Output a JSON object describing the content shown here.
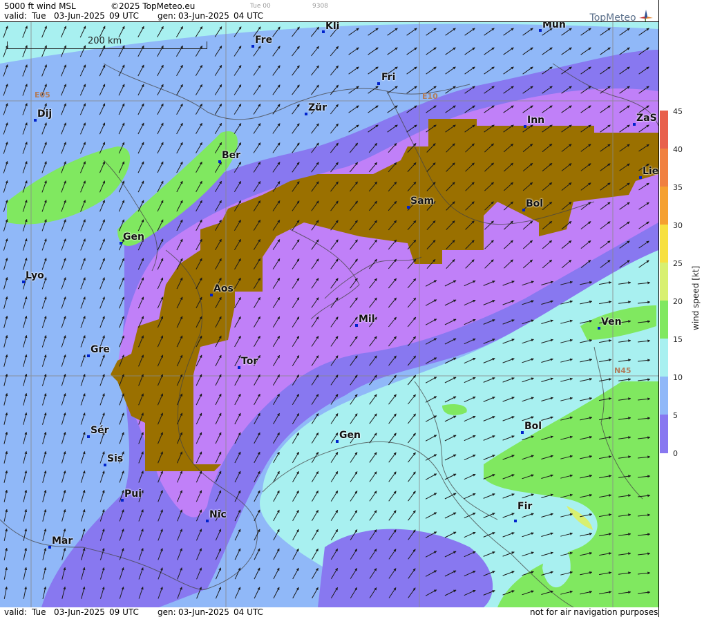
{
  "header": {
    "product": "5000 ft wind MSL",
    "copyright": "©2025 TopMeteo.eu",
    "valid_label": "valid:",
    "valid_day": "Tue",
    "valid_date": "03-Jun-2025",
    "valid_time": "09 UTC",
    "gen_label": "gen:",
    "gen_date": "03-Jun-2025",
    "gen_time": "04 UTC",
    "grey_tag1": "Tue 00",
    "grey_tag2": "9308"
  },
  "logo_text": "TopMeteo",
  "scale_label": "200 km",
  "grid_labels": {
    "e05": "E05",
    "e10": "E10",
    "n45": "N45"
  },
  "cities": [
    {
      "name": "Kli"
    },
    {
      "name": "Mün"
    },
    {
      "name": "Fre"
    },
    {
      "name": "Fri"
    },
    {
      "name": "Dij"
    },
    {
      "name": "Zür"
    },
    {
      "name": "Inn"
    },
    {
      "name": "ZaS"
    },
    {
      "name": "Ber"
    },
    {
      "name": "Lie"
    },
    {
      "name": "Sam"
    },
    {
      "name": "Bol"
    },
    {
      "name": "Gen"
    },
    {
      "name": "Lyo"
    },
    {
      "name": "Aos"
    },
    {
      "name": "Mil"
    },
    {
      "name": "Ven"
    },
    {
      "name": "Gre"
    },
    {
      "name": "Tor"
    },
    {
      "name": "Sér"
    },
    {
      "name": "Gen"
    },
    {
      "name": "Bol"
    },
    {
      "name": "Sis"
    },
    {
      "name": "Pui"
    },
    {
      "name": "Fir"
    },
    {
      "name": "Nic"
    },
    {
      "name": "Mar"
    }
  ],
  "legend": {
    "title": "wind speed [kt]",
    "ticks": [
      "45",
      "40",
      "35",
      "30",
      "25",
      "20",
      "15",
      "10",
      "5",
      "0"
    ],
    "colors": [
      "#e8604c",
      "#f08040",
      "#f5a030",
      "#f7e040",
      "#d8f070",
      "#80e860",
      "#a8f0f0",
      "#90b8f8",
      "#8878f0",
      "#c080f8"
    ],
    "terrain_color": "#9a7000"
  },
  "footer": {
    "valid_label": "valid:",
    "valid_day": "Tue",
    "valid_date": "03-Jun-2025",
    "valid_time": "09 UTC",
    "gen_label": "gen:",
    "gen_date": "03-Jun-2025",
    "gen_time": "04 UTC",
    "disclaimer": "not for air navigation purposes"
  }
}
